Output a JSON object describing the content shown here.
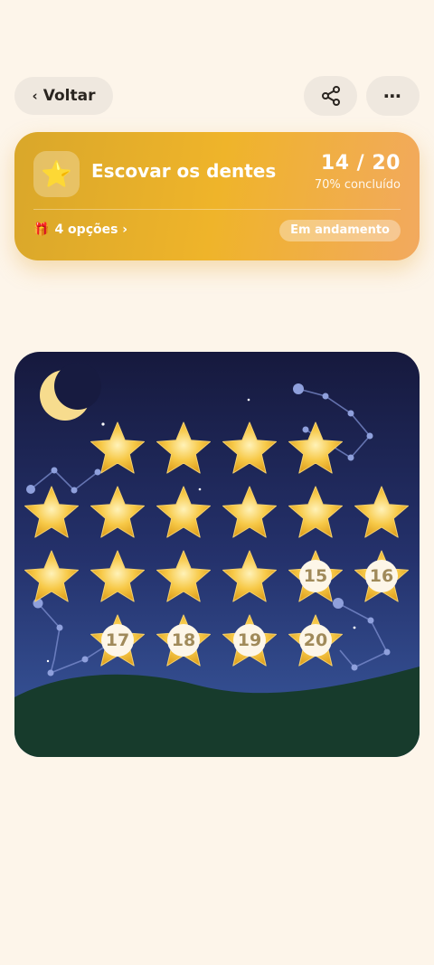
{
  "topbar": {
    "back_label": "Voltar",
    "share_icon": "share-icon",
    "more_label": "⋯"
  },
  "habit": {
    "emoji": "⭐",
    "title": "Escovar os dentes",
    "progress_text": "14 / 20",
    "progress_fraction": 0.7,
    "percent_text": "70% concluído",
    "rewards_emoji": "🎁",
    "rewards_label": "4 opções ›",
    "status": "Em andamento"
  },
  "stars": {
    "total": 20,
    "completed": 14,
    "pending_numbers": [
      "15",
      "16",
      "17",
      "18",
      "19",
      "20"
    ]
  },
  "colors": {
    "background": "#fdf5ea",
    "card_gradient_start": "#d9a72a",
    "card_gradient_end": "#f2a95f",
    "sky_top": "#16193d",
    "sky_bottom": "#3a5aa0",
    "hill": "#173b2c",
    "star_fill": "#f7c948"
  }
}
